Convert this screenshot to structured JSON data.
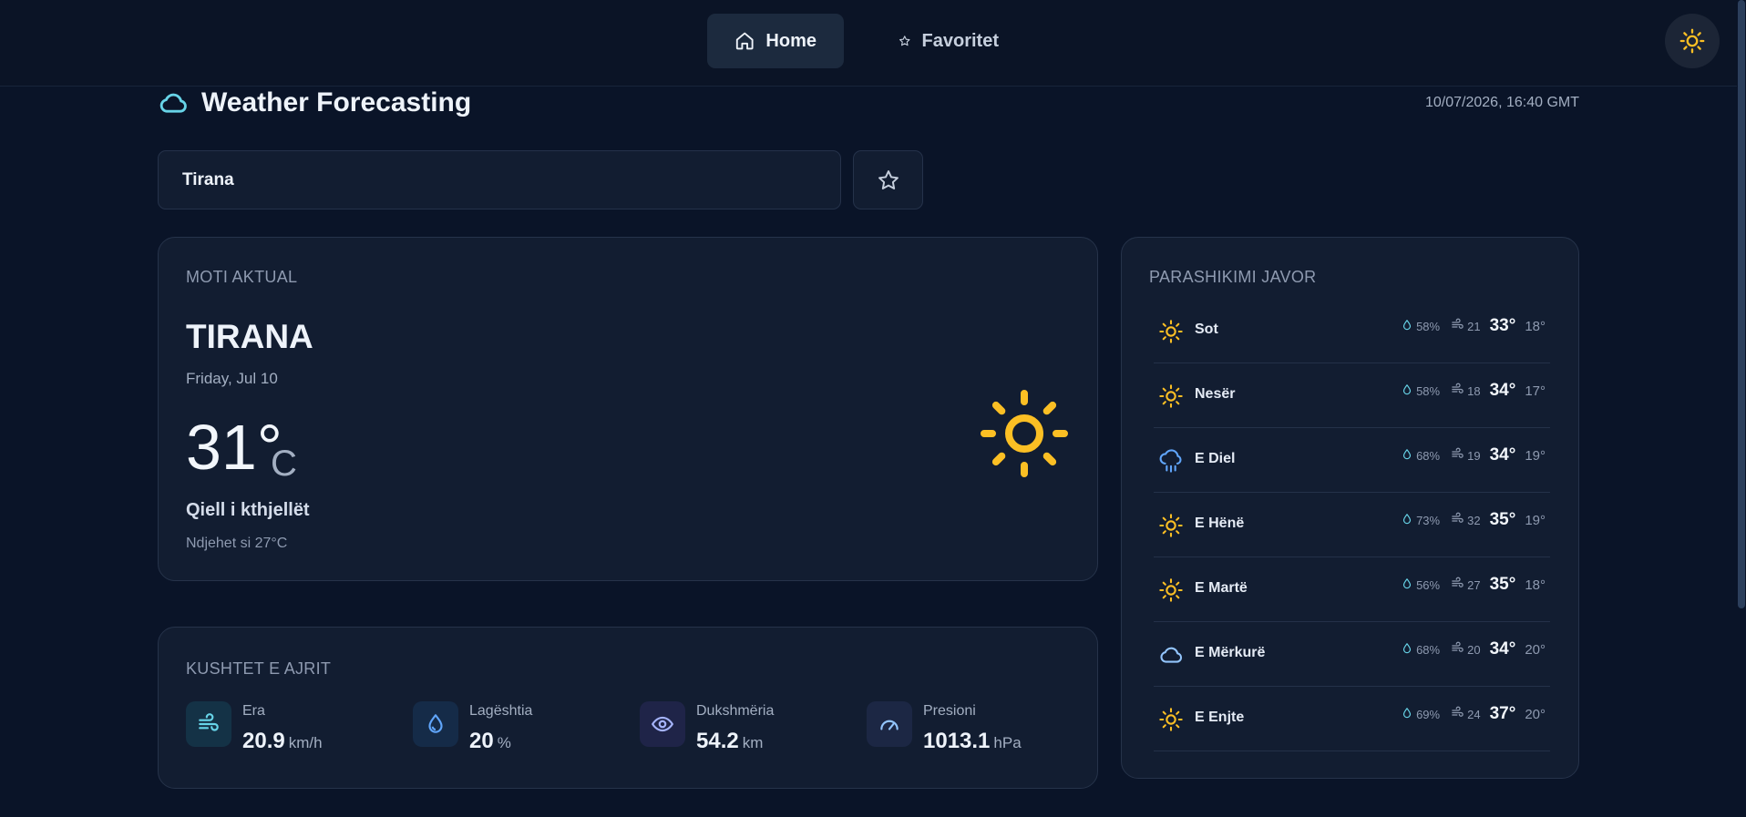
{
  "nav": {
    "home_label": "Home",
    "favorites_label": "Favoritet"
  },
  "header": {
    "title": "Weather Forecasting",
    "datetime": "10/07/2026, 16:40 GMT"
  },
  "search": {
    "value": "Tirana"
  },
  "current": {
    "section_title": "MOTI AKTUAL",
    "city": "TIRANA",
    "date": "Friday, Jul 10",
    "temp": "31°",
    "unit": "C",
    "condition": "Qiell i kthjellët",
    "feels_like": "Ndjehet si 27°C",
    "icon": "sun-icon"
  },
  "air": {
    "section_title": "KUSHTET E AJRIT",
    "metrics": [
      {
        "label": "Era",
        "value": "20.9",
        "unit": "km/h",
        "icon": "wind-icon"
      },
      {
        "label": "Lagështia",
        "value": "20",
        "unit": "%",
        "icon": "droplet-icon"
      },
      {
        "label": "Dukshmëria",
        "value": "54.2",
        "unit": "km",
        "icon": "eye-icon"
      },
      {
        "label": "Presioni",
        "value": "1013.1",
        "unit": "hPa",
        "icon": "gauge-icon"
      }
    ]
  },
  "weekly": {
    "section_title": "PARASHIKIMI JAVOR",
    "days": [
      {
        "name": "Sot",
        "icon": "sun",
        "rain": "58%",
        "wind": "21",
        "high": "33°",
        "low": "18°"
      },
      {
        "name": "Nesër",
        "icon": "sun",
        "rain": "58%",
        "wind": "18",
        "high": "34°",
        "low": "17°"
      },
      {
        "name": "E Diel",
        "icon": "rain",
        "rain": "68%",
        "wind": "19",
        "high": "34°",
        "low": "19°"
      },
      {
        "name": "E Hënë",
        "icon": "sun",
        "rain": "73%",
        "wind": "32",
        "high": "35°",
        "low": "19°"
      },
      {
        "name": "E Martë",
        "icon": "sun",
        "rain": "56%",
        "wind": "27",
        "high": "35°",
        "low": "18°"
      },
      {
        "name": "E Mërkurë",
        "icon": "cloud",
        "rain": "68%",
        "wind": "20",
        "high": "34°",
        "low": "20°"
      },
      {
        "name": "E Enjte",
        "icon": "sun",
        "rain": "69%",
        "wind": "24",
        "high": "37°",
        "low": "20°"
      }
    ]
  },
  "colors": {
    "background": "#0a1428",
    "card": "#121d31",
    "sun": "#fbbf24",
    "accent_cyan": "#67d4e8",
    "rain_blue": "#60a5fa"
  }
}
